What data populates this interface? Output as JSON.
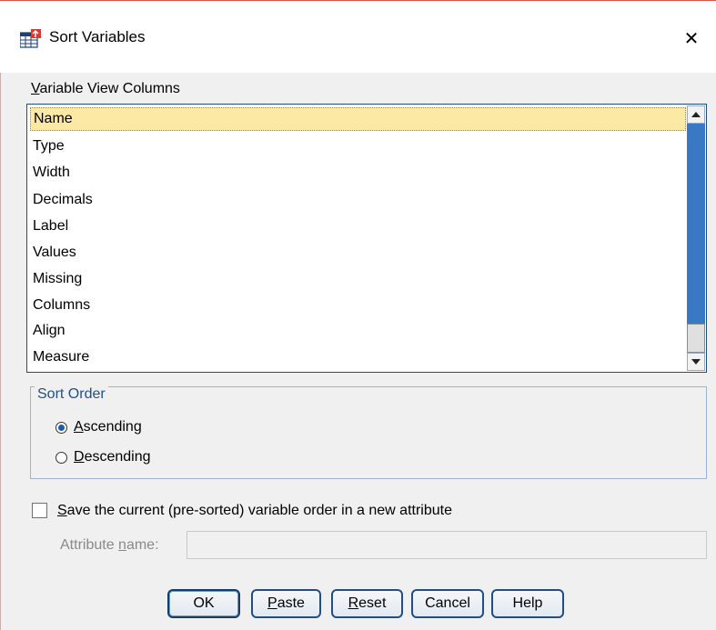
{
  "window": {
    "title": "Sort Variables",
    "close_glyph": "✕"
  },
  "columns_list": {
    "label_mnemonic": "V",
    "label_rest": "ariable View Columns",
    "items": [
      "Name",
      "Type",
      "Width",
      "Decimals",
      "Label",
      "Values",
      "Missing",
      "Columns",
      "Align",
      "Measure"
    ],
    "selected_index": 0
  },
  "sort_order": {
    "legend": "Sort Order",
    "ascending": {
      "mnemonic": "A",
      "rest": "scending",
      "checked": true
    },
    "descending": {
      "mnemonic": "D",
      "rest": "escending",
      "checked": false
    }
  },
  "save_option": {
    "checked": false,
    "label_mnemonic": "S",
    "label_rest": "ave the current (pre-sorted) variable order in a new attribute"
  },
  "attribute_name": {
    "label_pre": "Attribute ",
    "label_mnemonic": "n",
    "label_post": "ame:",
    "value": ""
  },
  "buttons": {
    "ok": {
      "label": "OK"
    },
    "paste": {
      "mnemonic": "P",
      "rest": "aste"
    },
    "reset": {
      "mnemonic": "R",
      "rest": "eset"
    },
    "cancel": {
      "label": "Cancel"
    },
    "help": {
      "label": "Help"
    }
  }
}
